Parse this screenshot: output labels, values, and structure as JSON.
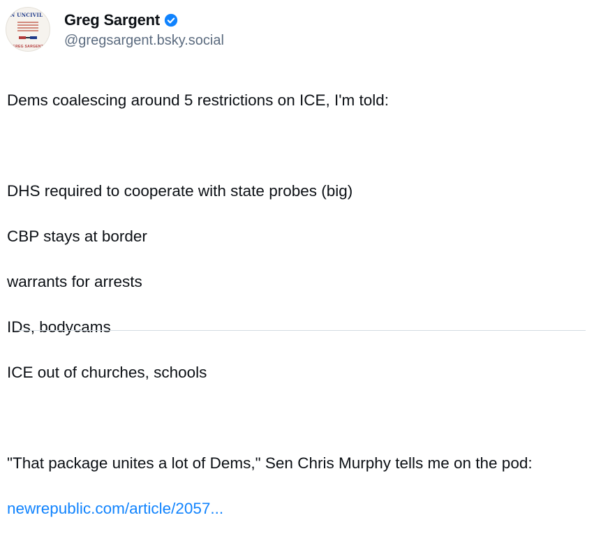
{
  "author": {
    "display_name": "Greg Sargent",
    "handle": "@gregsargent.bsky.social",
    "verified": true,
    "verified_color": "#1083fe",
    "avatar": {
      "cover_title": "AN UNCIVIL WAR",
      "cover_author": "GREG SARGENT"
    }
  },
  "post": {
    "intro": "Dems coalescing around 5 restrictions on ICE, I'm told:",
    "items": [
      "DHS required to cooperate with state probes (big)",
      "CBP stays at border",
      "warrants for arrests",
      "IDs, bodycams",
      "ICE out of churches, schools"
    ],
    "quote": "\"That package unites a lot of Dems,\" Sen Chris Murphy tells me on the pod:",
    "link_text": "newrepublic.com/article/2057..."
  },
  "colors": {
    "text": "#0b0f14",
    "muted": "#5b6b7f",
    "link": "#1083fe"
  }
}
